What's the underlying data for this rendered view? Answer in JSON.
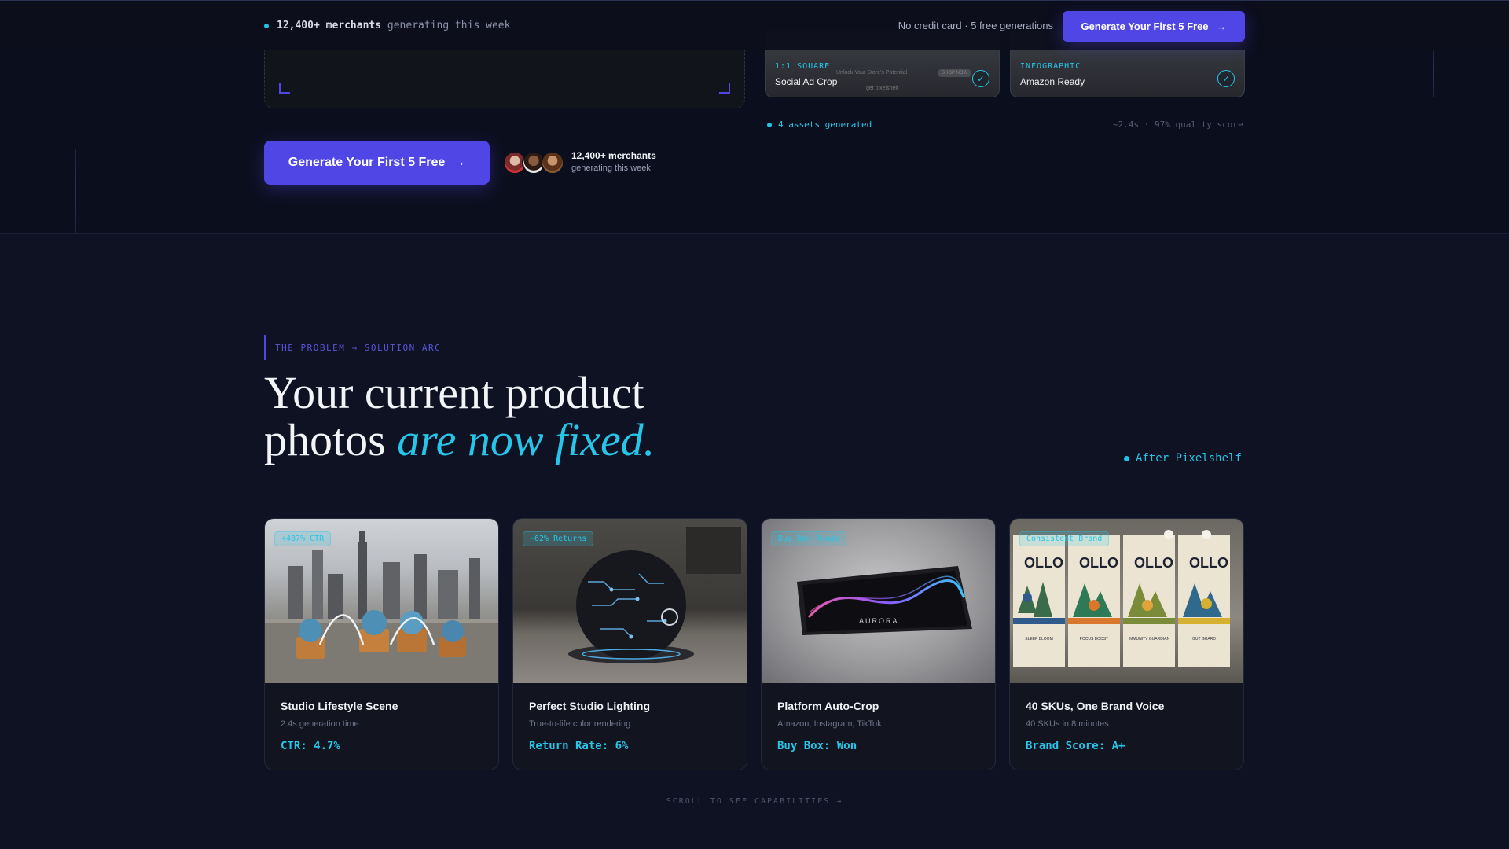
{
  "topbar": {
    "live_count": "12,400+ merchants",
    "live_suffix": "generating this week",
    "note": "No credit card · 5 free generations",
    "cta_label": "Generate Your First 5 Free"
  },
  "hero": {
    "cta_label": "Generate Your First 5 Free",
    "merchants_count": "12,400+ merchants",
    "merchants_sub": "generating this week"
  },
  "assets": [
    {
      "tag": "1:1 SQUARE",
      "title": "Social Ad Crop",
      "faint_text": "Unlock Your Store's Potential",
      "faint_button": "SHOP NOW",
      "faint_url": "get pixelshelf"
    },
    {
      "tag": "INFOGRAPHIC",
      "title": "Amazon Ready"
    }
  ],
  "assets_meta": {
    "generated": "4 assets generated",
    "stats": "~2.4s · 97% quality score"
  },
  "problem": {
    "eyebrow": "THE PROBLEM → SOLUTION ARC",
    "headline_line1": "Your current product",
    "headline_line2_plain": "photos",
    "headline_line2_accent": "are now fixed.",
    "after_label": "After Pixelshelf"
  },
  "cards": [
    {
      "badge": "+487% CTR",
      "title": "Studio Lifestyle Scene",
      "sub": "2.4s generation time",
      "metric": "CTR: 4.7%"
    },
    {
      "badge": "−62% Returns",
      "title": "Perfect Studio Lighting",
      "sub": "True-to-life color rendering",
      "metric": "Return Rate: 6%"
    },
    {
      "badge": "Buy Box Ready",
      "title": "Platform Auto-Crop",
      "sub": "Amazon, Instagram, TikTok",
      "metric": "Buy Box: Won",
      "product_label": "AURORA"
    },
    {
      "badge": "Consistent Brand",
      "title": "40 SKUs, One Brand Voice",
      "sub": "40 SKUs in 8 minutes",
      "metric": "Brand Score: A+",
      "product_label": "OLLO",
      "pack_names": [
        "SLEEP BLOOM",
        "FOCUS BOOST",
        "IMMUNITY GUARDIAN",
        "GUT GUARD"
      ]
    }
  ],
  "scroll_hint": "SCROLL TO SEE CAPABILITIES →",
  "colors": {
    "accent": "#27c5e8",
    "brand": "#4f46e5",
    "bg": "#0e1222"
  }
}
